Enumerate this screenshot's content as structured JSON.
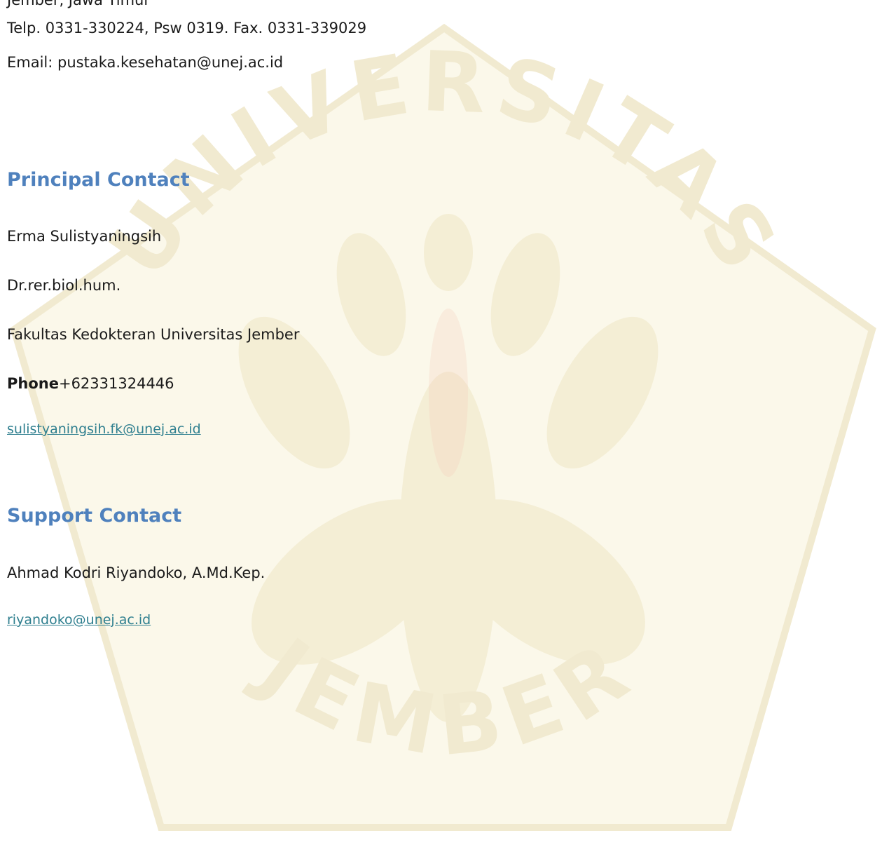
{
  "address": {
    "cut_line": "Jember, Jawa Timur",
    "phone_line": "Telp. 0331-330224, Psw 0319. Fax. 0331-339029",
    "email_line": "Email: pustaka.kesehatan@unej.ac.id"
  },
  "principal_contact": {
    "heading": "Principal Contact",
    "name": "Erma Sulistyaningsih",
    "title": "Dr.rer.biol.hum.",
    "affiliation": "Fakultas Kedokteran Universitas Jember",
    "phone_label": "Phone",
    "phone_value": "+62331324446",
    "email": "sulistyaningsih.fk@unej.ac.id"
  },
  "support_contact": {
    "heading": "Support Contact",
    "name": "Ahmad Kodri Riyandoko, A.Md.Kep.",
    "email": "riyandoko@unej.ac.id"
  },
  "watermark": {
    "top_text": "UNIVERSITAS",
    "bottom_text": "JEMBER",
    "color": "#e6d57a"
  }
}
